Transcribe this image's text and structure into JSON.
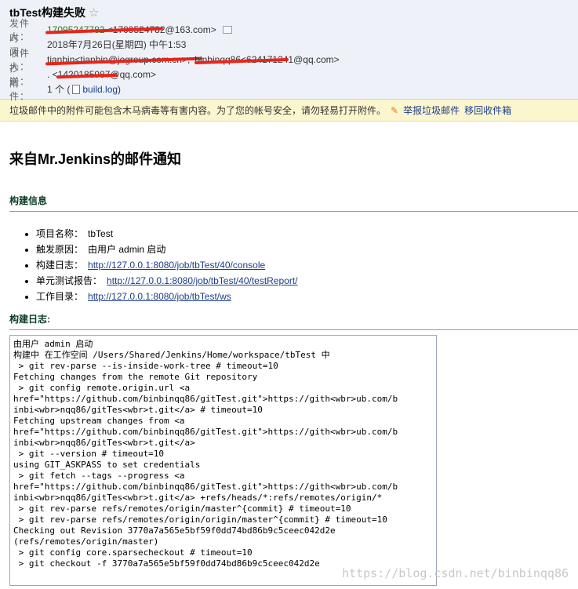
{
  "header": {
    "subject": "tbTest构建失败",
    "star_glyph": "☆",
    "sender_label": "发件人：",
    "sender_name": "17095247782",
    "sender_email": "<1709524782@163.com>",
    "time_label": "时　间：",
    "time_value": "2018年7月26日(星期四) 中午1:53",
    "recipients_label": "收件人：",
    "recipient_1": "tianbin<tianbin@jegroup.com.cn>;",
    "recipient_2": "binbinqq86<624171241@qq.com>",
    "cc_label": "抄　送：",
    "cc_value": ". <1420185987@qq.com>",
    "attach_label": "附　件：",
    "attach_count": "1 个 (",
    "attach_file": "build.log",
    "attach_close": ")"
  },
  "warning": {
    "text": "垃圾邮件中的附件可能包含木马病毒等有害内容。为了您的帐号安全，请勿轻易打开附件。",
    "report_label": "举报垃圾邮件",
    "move_label": "移回收件箱"
  },
  "body": {
    "title": "来自Mr.Jenkins的邮件通知",
    "build_info_title": "构建信息",
    "build_info": [
      {
        "label": "项目名称：",
        "value": "tbTest",
        "link": false
      },
      {
        "label": "触发原因：",
        "value": "由用户 admin 启动",
        "link": false
      },
      {
        "label": "构建日志：",
        "value": "http://127.0.0.1:8080/job/tbTest/40/console",
        "link": true
      },
      {
        "label": "单元测试报告：",
        "value": "http://127.0.0.1:8080/job/tbTest/40/testReport/",
        "link": true
      },
      {
        "label": "工作目录：",
        "value": "http://127.0.0.1:8080/job/tbTest/ws",
        "link": true
      }
    ],
    "build_log_title": "构建日志:",
    "log_lines": [
      "由用户 admin 启动",
      "构建中 在工作空间 /Users/Shared/Jenkins/Home/workspace/tbTest 中",
      " > git rev-parse --is-inside-work-tree # timeout=10",
      "Fetching changes from the remote Git repository",
      " > git config remote.origin.url <a",
      "href=\"https://github.com/binbinqq86/gitTest.git\">https://gith<wbr>ub.com/b",
      "inbi<wbr>nqq86/gitTes<wbr>t.git</a> # timeout=10",
      "Fetching upstream changes from <a",
      "href=\"https://github.com/binbinqq86/gitTest.git\">https://gith<wbr>ub.com/b",
      "inbi<wbr>nqq86/gitTes<wbr>t.git</a>",
      " > git --version # timeout=10",
      "using GIT_ASKPASS to set credentials",
      " > git fetch --tags --progress <a",
      "href=\"https://github.com/binbinqq86/gitTest.git\">https://gith<wbr>ub.com/b",
      "inbi<wbr>nqq86/gitTes<wbr>t.git</a> +refs/heads/*:refs/remotes/origin/*",
      " > git rev-parse refs/remotes/origin/master^{commit} # timeout=10",
      " > git rev-parse refs/remotes/origin/origin/master^{commit} # timeout=10",
      "Checking out Revision 3770a7a565e5bf59f0dd74bd86b9c5ceec042d2e",
      "(refs/remotes/origin/master)",
      " > git config core.sparsecheckout # timeout=10",
      " > git checkout -f 3770a7a565e5bf59f0dd74bd86b9c5ceec042d2e"
    ]
  },
  "watermark": "https://blog.csdn.net/binbinqq86",
  "colors": {
    "header_bg": "#eef2f8",
    "warning_bg": "#fcf6cf",
    "link": "#1a3d8a",
    "section_title": "#0c3c26",
    "redaction": "#e8251b"
  }
}
